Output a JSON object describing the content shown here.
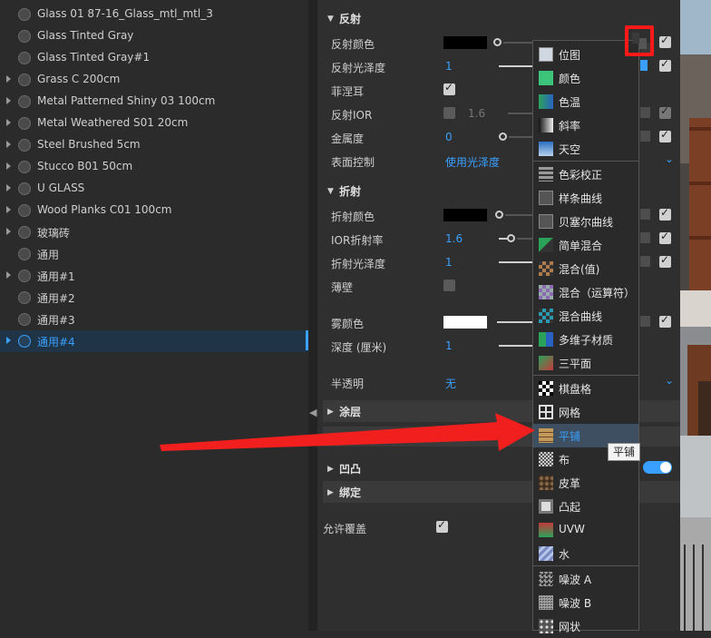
{
  "materials": [
    {
      "name": "Glass 01 87-16_Glass_mtl_mtl_3",
      "expandable": false
    },
    {
      "name": "Glass Tinted Gray",
      "expandable": false
    },
    {
      "name": "Glass Tinted Gray#1",
      "expandable": false
    },
    {
      "name": "Grass C 200cm",
      "expandable": true
    },
    {
      "name": "Metal Patterned Shiny 03 100cm",
      "expandable": true
    },
    {
      "name": "Metal Weathered S01 20cm",
      "expandable": true
    },
    {
      "name": "Steel Brushed 5cm",
      "expandable": true
    },
    {
      "name": "Stucco B01 50cm",
      "expandable": true
    },
    {
      "name": "U GLASS",
      "expandable": true
    },
    {
      "name": "Wood Planks C01 100cm",
      "expandable": true
    },
    {
      "name": "玻璃砖",
      "expandable": true
    },
    {
      "name": "通用",
      "expandable": false
    },
    {
      "name": "通用#1",
      "expandable": true
    },
    {
      "name": "通用#2",
      "expandable": false
    },
    {
      "name": "通用#3",
      "expandable": false
    },
    {
      "name": "通用#4",
      "expandable": true,
      "selected": true
    }
  ],
  "reflection": {
    "title": "反射",
    "color_label": "反射颜色",
    "color_value": "#000000",
    "gloss_label": "反射光泽度",
    "gloss_value": "1",
    "fresnel_label": "菲涅耳",
    "ior_label": "反射IOR",
    "ior_value": "1.6",
    "metal_label": "金属度",
    "metal_value": "0",
    "surface_label": "表面控制",
    "surface_value": "使用光泽度"
  },
  "refraction": {
    "title": "折射",
    "color_label": "折射颜色",
    "color_value": "#000000",
    "ior_label": "IOR折射率",
    "ior_value": "1.6",
    "gloss_label": "折射光泽度",
    "gloss_value": "1",
    "thin_label": "薄壁",
    "fog_label": "雾颜色",
    "fog_value": "#ffffff",
    "depth_label": "深度 (厘米)",
    "depth_value": "1",
    "translucency_label": "半透明",
    "translucency_value": "无"
  },
  "sections": {
    "coat": "涂层",
    "bump": "凹凸",
    "binding": "绑定"
  },
  "allow_override_label": "允许覆盖",
  "texture_menu": {
    "groups": [
      [
        "位图",
        "颜色",
        "色温",
        "斜率",
        "天空"
      ],
      [
        "色彩校正",
        "样条曲线",
        "贝塞尔曲线",
        "简单混合",
        "混合(值)",
        "混合（运算符）",
        "混合曲线",
        "多维子材质",
        "三平面"
      ],
      [
        "棋盘格",
        "网格",
        "平铺",
        "布",
        "皮革",
        "凸起",
        "UVW",
        "水"
      ],
      [
        "噪波 A",
        "噪波 B",
        "网状"
      ]
    ],
    "highlighted": "平铺"
  },
  "tooltip": "平铺",
  "colors": {
    "accent": "#3aa0ff",
    "annotation_red": "#ff1a1a",
    "panel_bg": "#2f2f2f",
    "sidebar_bg": "#2b2b2b"
  }
}
